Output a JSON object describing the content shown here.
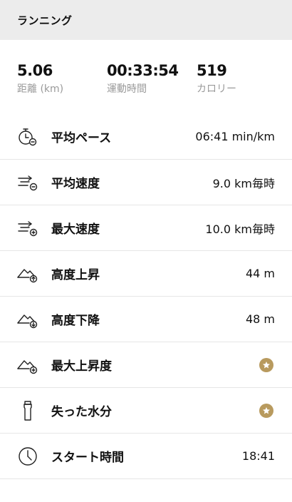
{
  "header": {
    "title": "ランニング"
  },
  "summary": {
    "distance": {
      "value": "5.06",
      "label": "距離 (km)"
    },
    "duration": {
      "value": "00:33:54",
      "label": "運動時間"
    },
    "calories": {
      "value": "519",
      "label": "カロリー"
    }
  },
  "rows": [
    {
      "label": "平均ペース",
      "value": "06:41 min/km",
      "icon": "stopwatch-icon"
    },
    {
      "label": "平均速度",
      "value": "9.0 km毎時",
      "icon": "speed-average-icon"
    },
    {
      "label": "最大速度",
      "value": "10.0 km毎時",
      "icon": "speed-max-icon"
    },
    {
      "label": "高度上昇",
      "value": "44 m",
      "icon": "elevation-up-icon"
    },
    {
      "label": "高度下降",
      "value": "48 m",
      "icon": "elevation-down-icon"
    },
    {
      "label": "最大上昇度",
      "value": "",
      "icon": "mountain-max-icon",
      "badge": "star-icon"
    },
    {
      "label": "失った水分",
      "value": "",
      "icon": "water-bottle-icon",
      "badge": "star-icon"
    },
    {
      "label": "スタート時間",
      "value": "18:41",
      "icon": "clock-icon"
    }
  ],
  "colors": {
    "header_bg": "#ececec",
    "label_gray": "#9a9a9a",
    "badge_gold": "#b89a5e"
  }
}
